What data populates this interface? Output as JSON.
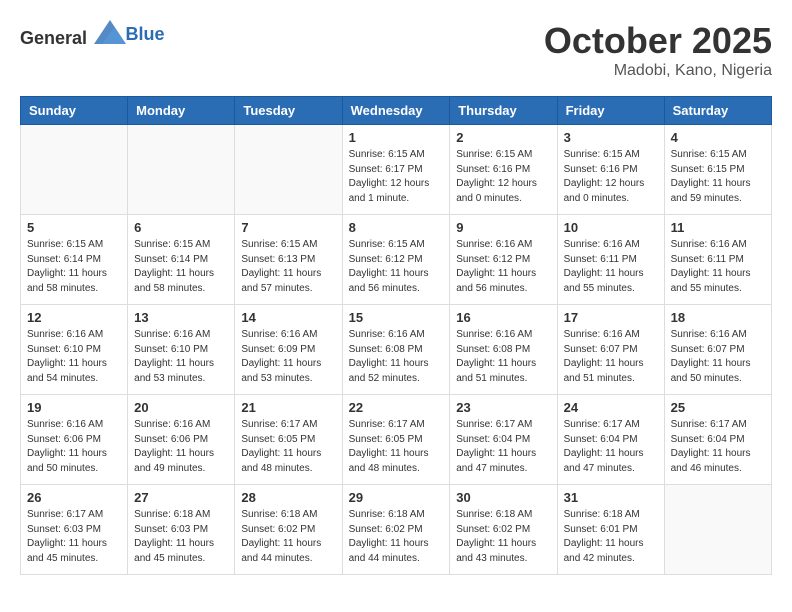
{
  "header": {
    "logo_general": "General",
    "logo_blue": "Blue",
    "month": "October 2025",
    "location": "Madobi, Kano, Nigeria"
  },
  "weekdays": [
    "Sunday",
    "Monday",
    "Tuesday",
    "Wednesday",
    "Thursday",
    "Friday",
    "Saturday"
  ],
  "weeks": [
    [
      {
        "day": "",
        "info": ""
      },
      {
        "day": "",
        "info": ""
      },
      {
        "day": "",
        "info": ""
      },
      {
        "day": "1",
        "info": "Sunrise: 6:15 AM\nSunset: 6:17 PM\nDaylight: 12 hours\nand 1 minute."
      },
      {
        "day": "2",
        "info": "Sunrise: 6:15 AM\nSunset: 6:16 PM\nDaylight: 12 hours\nand 0 minutes."
      },
      {
        "day": "3",
        "info": "Sunrise: 6:15 AM\nSunset: 6:16 PM\nDaylight: 12 hours\nand 0 minutes."
      },
      {
        "day": "4",
        "info": "Sunrise: 6:15 AM\nSunset: 6:15 PM\nDaylight: 11 hours\nand 59 minutes."
      }
    ],
    [
      {
        "day": "5",
        "info": "Sunrise: 6:15 AM\nSunset: 6:14 PM\nDaylight: 11 hours\nand 58 minutes."
      },
      {
        "day": "6",
        "info": "Sunrise: 6:15 AM\nSunset: 6:14 PM\nDaylight: 11 hours\nand 58 minutes."
      },
      {
        "day": "7",
        "info": "Sunrise: 6:15 AM\nSunset: 6:13 PM\nDaylight: 11 hours\nand 57 minutes."
      },
      {
        "day": "8",
        "info": "Sunrise: 6:15 AM\nSunset: 6:12 PM\nDaylight: 11 hours\nand 56 minutes."
      },
      {
        "day": "9",
        "info": "Sunrise: 6:16 AM\nSunset: 6:12 PM\nDaylight: 11 hours\nand 56 minutes."
      },
      {
        "day": "10",
        "info": "Sunrise: 6:16 AM\nSunset: 6:11 PM\nDaylight: 11 hours\nand 55 minutes."
      },
      {
        "day": "11",
        "info": "Sunrise: 6:16 AM\nSunset: 6:11 PM\nDaylight: 11 hours\nand 55 minutes."
      }
    ],
    [
      {
        "day": "12",
        "info": "Sunrise: 6:16 AM\nSunset: 6:10 PM\nDaylight: 11 hours\nand 54 minutes."
      },
      {
        "day": "13",
        "info": "Sunrise: 6:16 AM\nSunset: 6:10 PM\nDaylight: 11 hours\nand 53 minutes."
      },
      {
        "day": "14",
        "info": "Sunrise: 6:16 AM\nSunset: 6:09 PM\nDaylight: 11 hours\nand 53 minutes."
      },
      {
        "day": "15",
        "info": "Sunrise: 6:16 AM\nSunset: 6:08 PM\nDaylight: 11 hours\nand 52 minutes."
      },
      {
        "day": "16",
        "info": "Sunrise: 6:16 AM\nSunset: 6:08 PM\nDaylight: 11 hours\nand 51 minutes."
      },
      {
        "day": "17",
        "info": "Sunrise: 6:16 AM\nSunset: 6:07 PM\nDaylight: 11 hours\nand 51 minutes."
      },
      {
        "day": "18",
        "info": "Sunrise: 6:16 AM\nSunset: 6:07 PM\nDaylight: 11 hours\nand 50 minutes."
      }
    ],
    [
      {
        "day": "19",
        "info": "Sunrise: 6:16 AM\nSunset: 6:06 PM\nDaylight: 11 hours\nand 50 minutes."
      },
      {
        "day": "20",
        "info": "Sunrise: 6:16 AM\nSunset: 6:06 PM\nDaylight: 11 hours\nand 49 minutes."
      },
      {
        "day": "21",
        "info": "Sunrise: 6:17 AM\nSunset: 6:05 PM\nDaylight: 11 hours\nand 48 minutes."
      },
      {
        "day": "22",
        "info": "Sunrise: 6:17 AM\nSunset: 6:05 PM\nDaylight: 11 hours\nand 48 minutes."
      },
      {
        "day": "23",
        "info": "Sunrise: 6:17 AM\nSunset: 6:04 PM\nDaylight: 11 hours\nand 47 minutes."
      },
      {
        "day": "24",
        "info": "Sunrise: 6:17 AM\nSunset: 6:04 PM\nDaylight: 11 hours\nand 47 minutes."
      },
      {
        "day": "25",
        "info": "Sunrise: 6:17 AM\nSunset: 6:04 PM\nDaylight: 11 hours\nand 46 minutes."
      }
    ],
    [
      {
        "day": "26",
        "info": "Sunrise: 6:17 AM\nSunset: 6:03 PM\nDaylight: 11 hours\nand 45 minutes."
      },
      {
        "day": "27",
        "info": "Sunrise: 6:18 AM\nSunset: 6:03 PM\nDaylight: 11 hours\nand 45 minutes."
      },
      {
        "day": "28",
        "info": "Sunrise: 6:18 AM\nSunset: 6:02 PM\nDaylight: 11 hours\nand 44 minutes."
      },
      {
        "day": "29",
        "info": "Sunrise: 6:18 AM\nSunset: 6:02 PM\nDaylight: 11 hours\nand 44 minutes."
      },
      {
        "day": "30",
        "info": "Sunrise: 6:18 AM\nSunset: 6:02 PM\nDaylight: 11 hours\nand 43 minutes."
      },
      {
        "day": "31",
        "info": "Sunrise: 6:18 AM\nSunset: 6:01 PM\nDaylight: 11 hours\nand 42 minutes."
      },
      {
        "day": "",
        "info": ""
      }
    ]
  ]
}
